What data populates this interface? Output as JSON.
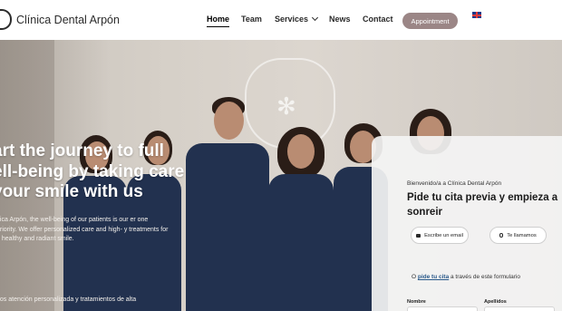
{
  "brand": {
    "name": "Clínica Dental Arpón"
  },
  "nav": {
    "items": [
      "Home",
      "Team",
      "Services",
      "News",
      "Contact"
    ],
    "active": "Home",
    "appointment_label": "Appointment",
    "language_icon": "uk-flag-icon"
  },
  "hero": {
    "title": "art the journey to full ell-being by taking care your smile with us",
    "title_lines": [
      "art the journey to full",
      "ell-being by taking care",
      "your smile with us"
    ],
    "paragraph": "nica Arpón, the well-being of our patients is our er one priority. We offer personalized care and high- y treatments for a healthy and radiant smile.",
    "paragraph2": "nos atención personalizada y tratamientos de alta"
  },
  "booking_card": {
    "welcome": "Bienvenido/a a Clínica Dental Arpón",
    "title": "Pide tu cita previa y empieza a sonreir",
    "email_button": "Escribe un email",
    "call_button": "Te llamamos",
    "form_prefix": "O",
    "form_link": "pide tu cita",
    "form_suffix": "a través de este formulario",
    "label_name": "Nombre",
    "label_lastname": "Apellidos"
  },
  "colors": {
    "accent": "#9b8686",
    "scrubs": "#22314f",
    "link": "#2b5a8a"
  }
}
